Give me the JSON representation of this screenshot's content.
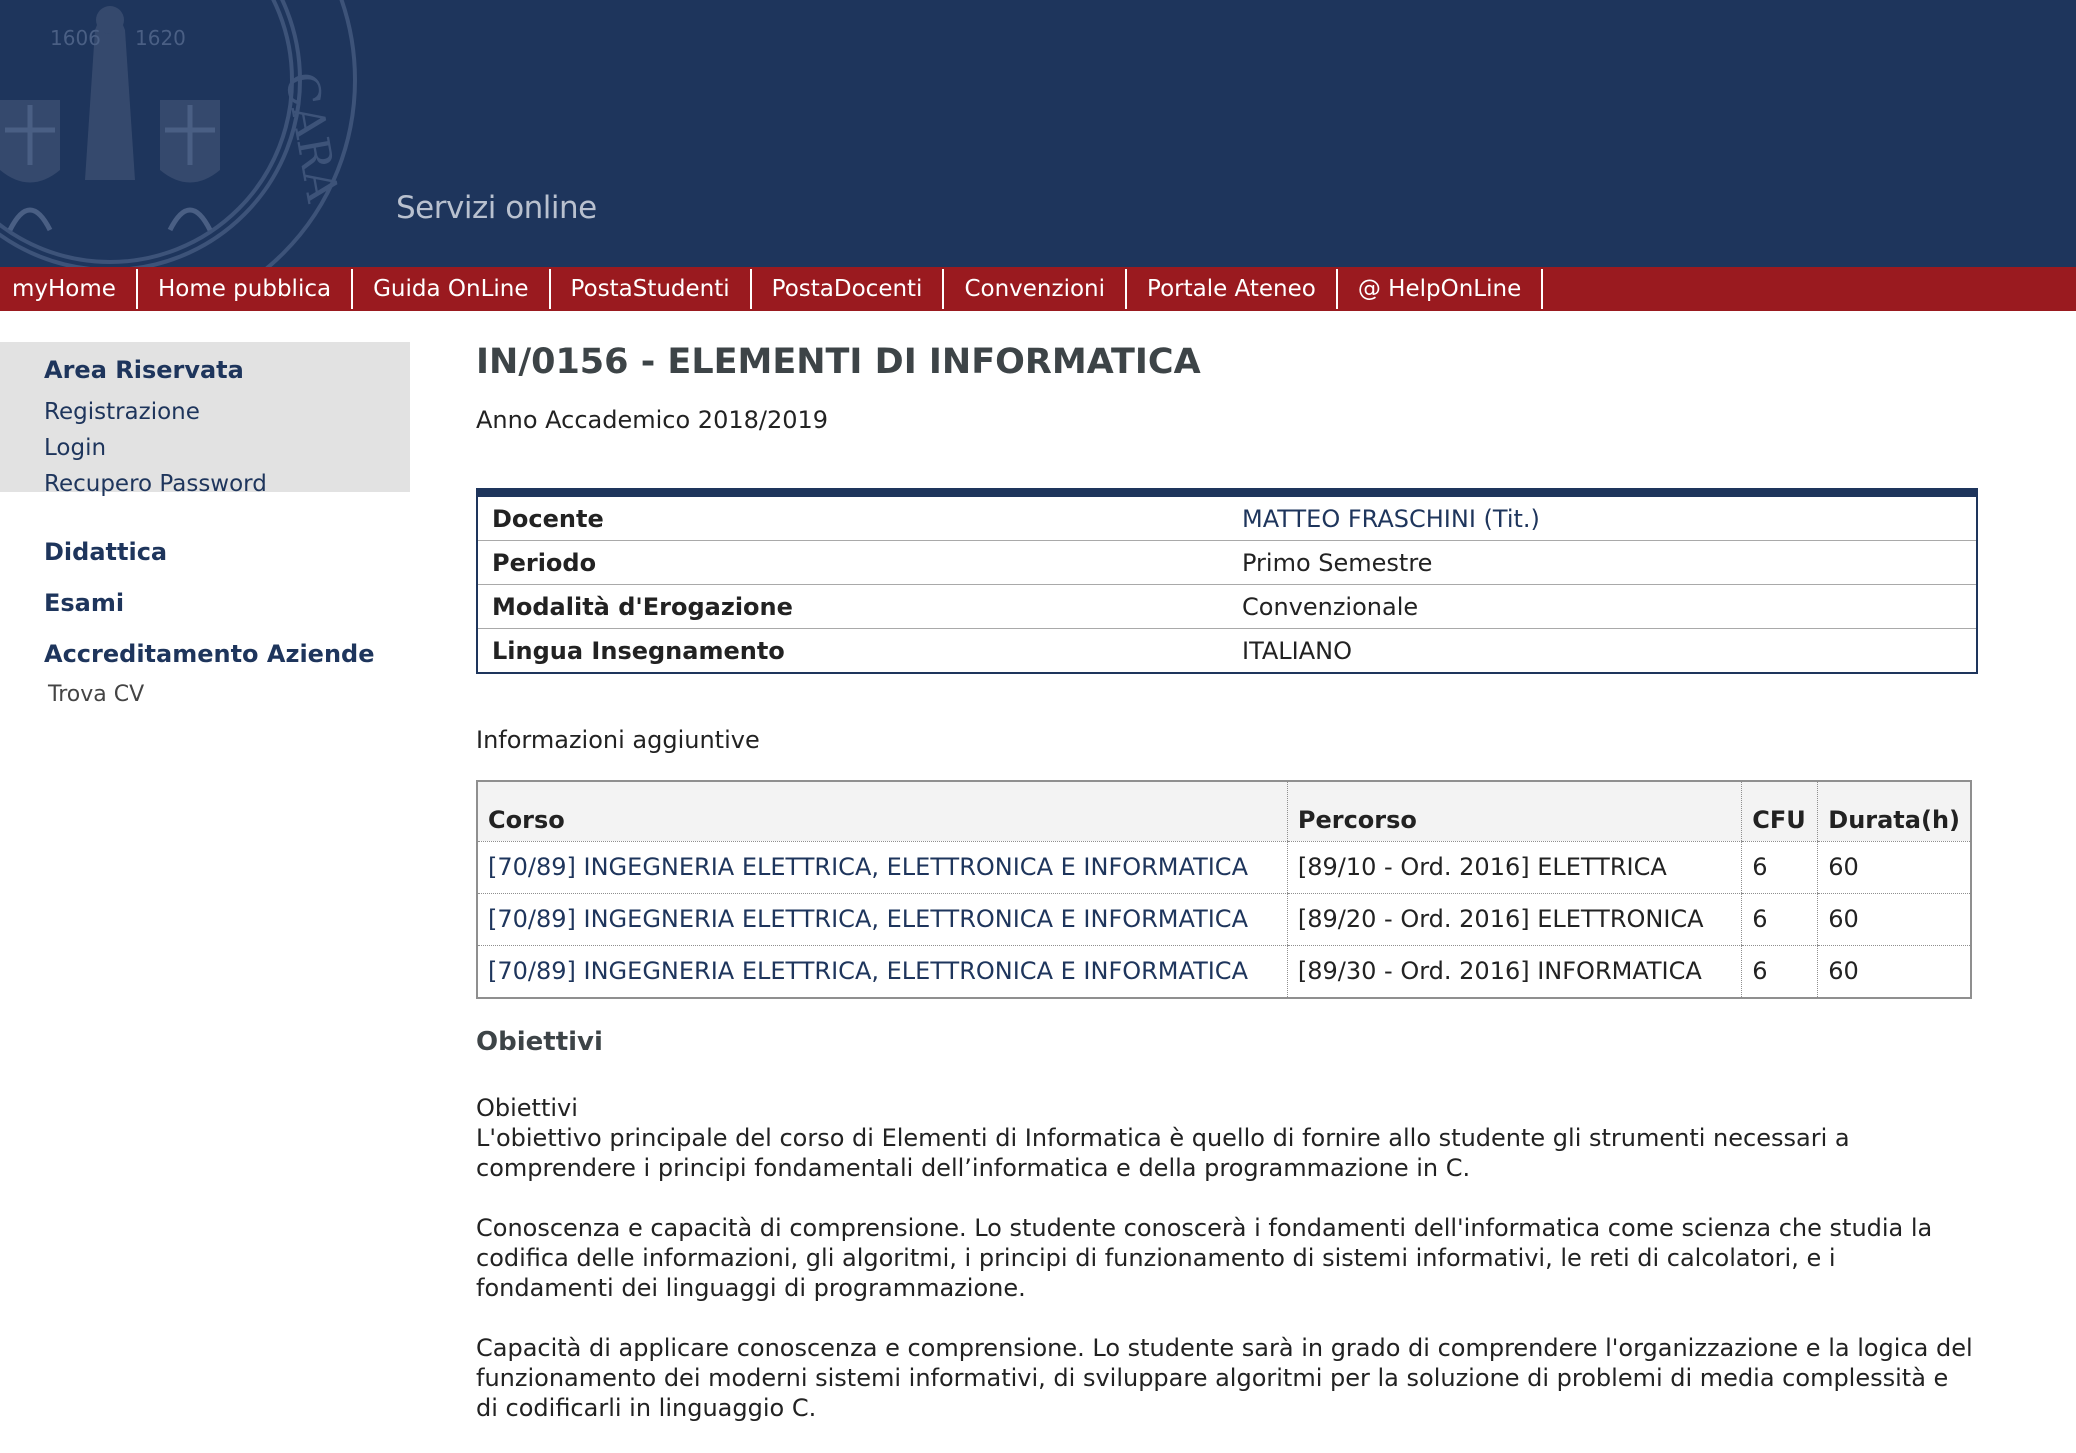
{
  "header": {
    "site_title": "Servizi online",
    "seal_text": "STVDIORVM CARALITANA",
    "seal_year_left": "1606",
    "seal_year_right": "1620"
  },
  "nav": {
    "items": [
      {
        "label": "myHome"
      },
      {
        "label": "Home pubblica"
      },
      {
        "label": "Guida OnLine"
      },
      {
        "label": "PostaStudenti"
      },
      {
        "label": "PostaDocenti"
      },
      {
        "label": "Convenzioni"
      },
      {
        "label": "Portale Ateneo"
      },
      {
        "label": "@ HelpOnLine"
      }
    ]
  },
  "sidebar": {
    "area_riservata": "Area Riservata",
    "area_links": [
      "Registrazione",
      "Login",
      "Recupero Password"
    ],
    "didattica": "Didattica",
    "esami": "Esami",
    "accreditamento": "Accreditamento Aziende",
    "trova_cv": "Trova CV"
  },
  "main": {
    "title": "IN/0156 - ELEMENTI DI INFORMATICA",
    "academic_year": "Anno Accademico 2018/2019",
    "info": [
      {
        "label": "Docente",
        "value": "MATTEO FRASCHINI (Tit.)"
      },
      {
        "label": "Periodo",
        "value": "Primo Semestre"
      },
      {
        "label": "Modalità d'Erogazione",
        "value": "Convenzionale"
      },
      {
        "label": "Lingua Insegnamento",
        "value": "ITALIANO"
      }
    ],
    "extra_label": "Informazioni aggiuntive",
    "course_table": {
      "headers": [
        "Corso",
        "Percorso",
        "CFU",
        "Durata(h)"
      ],
      "rows": [
        {
          "corso": "[70/89]  INGEGNERIA ELETTRICA, ELETTRONICA E INFORMATICA",
          "percorso": "[89/10 - Ord. 2016]  ELETTRICA",
          "cfu": "6",
          "durata": "60"
        },
        {
          "corso": "[70/89]  INGEGNERIA ELETTRICA, ELETTRONICA E INFORMATICA",
          "percorso": "[89/20 - Ord. 2016]  ELETTRONICA",
          "cfu": "6",
          "durata": "60"
        },
        {
          "corso": "[70/89]  INGEGNERIA ELETTRICA, ELETTRONICA E INFORMATICA",
          "percorso": "[89/30 - Ord. 2016]  INFORMATICA",
          "cfu": "6",
          "durata": "60"
        }
      ]
    },
    "objectives_title": "Obiettivi",
    "objectives": {
      "subheading": "Obiettivi",
      "p1": "L'obiettivo principale del corso di Elementi di Informatica è quello di fornire allo studente gli strumenti necessari a comprendere i principi fondamentali dell’informatica e della programmazione in C.",
      "p2": "Conoscenza e capacità di comprensione. Lo studente conoscerà i fondamenti dell'informatica come scienza che studia la codifica delle informazioni, gli algoritmi, i principi di funzionamento di sistemi informativi, le reti di calcolatori, e i fondamenti dei linguaggi di programmazione.",
      "p3": "Capacità di applicare conoscenza e comprensione. Lo studente sarà in grado di comprendere l'organizzazione e la logica del funzionamento dei moderni sistemi informativi, di sviluppare algoritmi per la soluzione di problemi di media complessità e di codificarli in linguaggio C."
    }
  },
  "colors": {
    "header_bg": "#1e355c",
    "nav_bg": "#9a1a1f",
    "link": "#1e355c",
    "sidebar_box": "#e2e2e2"
  }
}
